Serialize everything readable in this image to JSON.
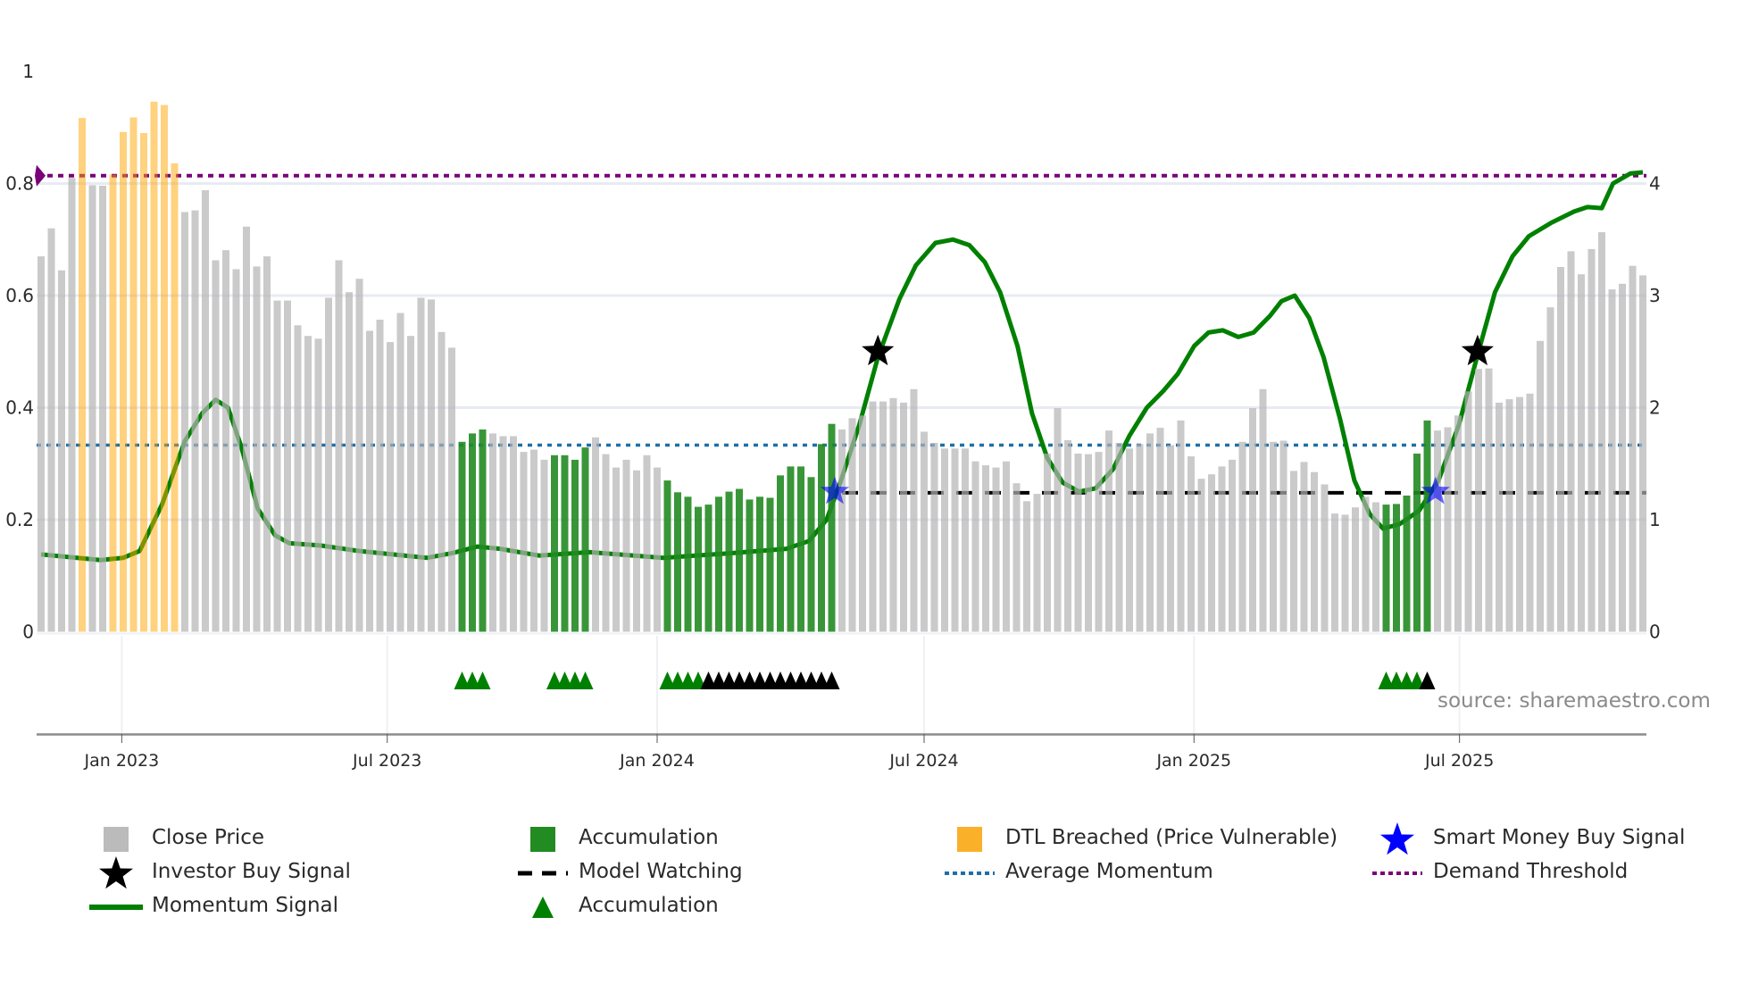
{
  "chart_data": {
    "type": "bar",
    "title": "",
    "x_start": "2022-11-07",
    "x_frequency": "weekly",
    "x_ticks": [
      "Jan 2023",
      "Jul 2023",
      "Jan 2024",
      "Jul 2024",
      "Jan 2025",
      "Jul 2025"
    ],
    "x_tick_dates": [
      "2023-01-01",
      "2023-07-01",
      "2024-01-01",
      "2024-07-01",
      "2025-01-01",
      "2025-07-01"
    ],
    "y_left": {
      "ticks": [
        "0",
        "0.2",
        "0.4",
        "0.6",
        "0.8",
        "1"
      ],
      "range": [
        0,
        1
      ]
    },
    "y_right": {
      "ticks": [
        "0",
        "1",
        "2",
        "3",
        "4"
      ],
      "range": [
        0,
        5
      ]
    },
    "grid": true,
    "close_price": [
      0.67,
      0.72,
      0.645,
      0.81,
      0.917,
      0.797,
      0.796,
      0.816,
      0.892,
      0.918,
      0.89,
      0.946,
      0.94,
      0.836,
      0.749,
      0.752,
      0.788,
      0.663,
      0.681,
      0.647,
      0.723,
      0.652,
      0.67,
      0.591,
      0.591,
      0.547,
      0.528,
      0.523,
      0.596,
      0.663,
      0.606,
      0.63,
      0.537,
      0.557,
      0.517,
      0.569,
      0.528,
      0.596,
      0.593,
      0.535,
      0.507,
      0.339,
      0.354,
      0.361,
      0.354,
      0.349,
      0.349,
      0.321,
      0.325,
      0.307,
      0.315,
      0.315,
      0.307,
      0.329,
      0.347,
      0.317,
      0.293,
      0.307,
      0.288,
      0.315,
      0.293,
      0.27,
      0.249,
      0.241,
      0.223,
      0.227,
      0.241,
      0.25,
      0.255,
      0.236,
      0.241,
      0.239,
      0.279,
      0.295,
      0.295,
      0.276,
      0.335,
      0.371,
      0.361,
      0.381,
      0.386,
      0.411,
      0.411,
      0.417,
      0.409,
      0.433,
      0.357,
      0.337,
      0.327,
      0.327,
      0.327,
      0.304,
      0.297,
      0.293,
      0.304,
      0.265,
      0.233,
      0.246,
      0.318,
      0.399,
      0.342,
      0.318,
      0.317,
      0.321,
      0.359,
      0.337,
      0.327,
      0.335,
      0.354,
      0.364,
      0.333,
      0.377,
      0.313,
      0.273,
      0.281,
      0.295,
      0.307,
      0.339,
      0.399,
      0.433,
      0.339,
      0.341,
      0.287,
      0.303,
      0.285,
      0.263,
      0.211,
      0.209,
      0.222,
      0.241,
      0.231,
      0.227,
      0.228,
      0.243,
      0.318,
      0.377,
      0.359,
      0.365,
      0.386,
      0.429,
      0.469,
      0.47,
      0.409,
      0.415,
      0.419,
      0.425,
      0.519,
      0.579,
      0.651,
      0.679,
      0.638,
      0.683,
      0.713,
      0.611,
      0.621,
      0.653,
      0.636
    ],
    "accumulation_bars": [
      41,
      42,
      43,
      50,
      51,
      52,
      53,
      61,
      62,
      63,
      64,
      65,
      66,
      67,
      68,
      69,
      70,
      71,
      72,
      73,
      74,
      75,
      76,
      77,
      131,
      132,
      133,
      134,
      135
    ],
    "dtl_breached_bars": [
      4,
      7,
      8,
      9,
      10,
      11,
      12,
      13
    ],
    "momentum_signal": [
      [
        0,
        0.69
      ],
      [
        5.8,
        0.64
      ],
      [
        8,
        0.66
      ],
      [
        9.6,
        0.72
      ],
      [
        11.8,
        1.14
      ],
      [
        14,
        1.7
      ],
      [
        15.7,
        1.95
      ],
      [
        17,
        2.07
      ],
      [
        18.2,
        2.0
      ],
      [
        19.5,
        1.65
      ],
      [
        21.1,
        1.1
      ],
      [
        22.8,
        0.86
      ],
      [
        24.2,
        0.79
      ],
      [
        27.2,
        0.77
      ],
      [
        31,
        0.72
      ],
      [
        37.6,
        0.66
      ],
      [
        40,
        0.7
      ],
      [
        42.5,
        0.76
      ],
      [
        44.7,
        0.74
      ],
      [
        48.5,
        0.68
      ],
      [
        53.4,
        0.71
      ],
      [
        60.6,
        0.66
      ],
      [
        67.1,
        0.7
      ],
      [
        72.6,
        0.74
      ],
      [
        74.8,
        0.81
      ],
      [
        76.5,
        1.0
      ],
      [
        77.9,
        1.35
      ],
      [
        79.7,
        1.85
      ],
      [
        81.5,
        2.45
      ],
      [
        83.6,
        2.97
      ],
      [
        85.2,
        3.27
      ],
      [
        87.1,
        3.47
      ],
      [
        88.8,
        3.5
      ],
      [
        90.4,
        3.45
      ],
      [
        91.9,
        3.3
      ],
      [
        93.4,
        3.03
      ],
      [
        95.1,
        2.55
      ],
      [
        96.5,
        1.95
      ],
      [
        98,
        1.55
      ],
      [
        99.5,
        1.33
      ],
      [
        101.1,
        1.25
      ],
      [
        102.7,
        1.28
      ],
      [
        104.4,
        1.45
      ],
      [
        106,
        1.75
      ],
      [
        107.7,
        2.0
      ],
      [
        109.3,
        2.15
      ],
      [
        110.7,
        2.3
      ],
      [
        112.3,
        2.55
      ],
      [
        113.7,
        2.67
      ],
      [
        115.1,
        2.69
      ],
      [
        116.6,
        2.63
      ],
      [
        118.1,
        2.67
      ],
      [
        119.7,
        2.82
      ],
      [
        120.8,
        2.95
      ],
      [
        122.1,
        3.0
      ],
      [
        123.5,
        2.8
      ],
      [
        124.9,
        2.45
      ],
      [
        126.5,
        1.9
      ],
      [
        127.9,
        1.35
      ],
      [
        129.4,
        1.05
      ],
      [
        130.7,
        0.92
      ],
      [
        132.3,
        0.96
      ],
      [
        134.2,
        1.08
      ],
      [
        136.1,
        1.35
      ],
      [
        138.1,
        1.85
      ],
      [
        139.9,
        2.47
      ],
      [
        141.6,
        3.03
      ],
      [
        143.3,
        3.35
      ],
      [
        144.9,
        3.53
      ],
      [
        147.1,
        3.65
      ],
      [
        149.3,
        3.75
      ],
      [
        150.6,
        3.79
      ],
      [
        152,
        3.78
      ],
      [
        153.1,
        4.0
      ],
      [
        154.8,
        4.09
      ],
      [
        156,
        4.1
      ]
    ],
    "average_momentum": 1.665,
    "demand_threshold": 4.07,
    "model_watching": {
      "level": 1.24,
      "from_index": 78
    },
    "investor_buy_signals": [
      [
        81.5,
        2.5
      ],
      [
        139.9,
        2.5
      ]
    ],
    "smart_money_buy_signals": [
      [
        77.3,
        1.25
      ],
      [
        135.8,
        1.25
      ]
    ],
    "accumulation_triangles": [
      41,
      42,
      43,
      50,
      51,
      52,
      53,
      61,
      62,
      63,
      64,
      131,
      132,
      133,
      134
    ],
    "watching_triangles": [
      65,
      66,
      67,
      68,
      69,
      70,
      71,
      72,
      73,
      74,
      75,
      76,
      77,
      135
    ],
    "legend": [
      {
        "label": "Close Price",
        "icon": "gray-square"
      },
      {
        "label": "Accumulation",
        "icon": "green-square"
      },
      {
        "label": "DTL Breached (Price Vulnerable)",
        "icon": "orange-square"
      },
      {
        "label": "Smart Money Buy Signal",
        "icon": "blue-star"
      },
      {
        "label": "Investor Buy Signal",
        "icon": "black-star"
      },
      {
        "label": "Model Watching",
        "icon": "black-dash"
      },
      {
        "label": "Average Momentum",
        "icon": "blue-dotted-line"
      },
      {
        "label": "Demand Threshold",
        "icon": "purple-dotted-line"
      },
      {
        "label": "Momentum Signal",
        "icon": "green-line"
      },
      {
        "label": "Accumulation",
        "icon": "green-triangle"
      }
    ],
    "legend_placement": "bottom",
    "annotation": "source: sharemaestro.com"
  },
  "colors": {
    "close": "#b4b4b4",
    "accumulation": "#228b22",
    "dtl": "#ffa500",
    "momentum": "#008000",
    "avg_momentum": "#1f6fa8",
    "threshold": "#7a007a",
    "smart_money": "#0000ff",
    "investor": "#000000"
  }
}
